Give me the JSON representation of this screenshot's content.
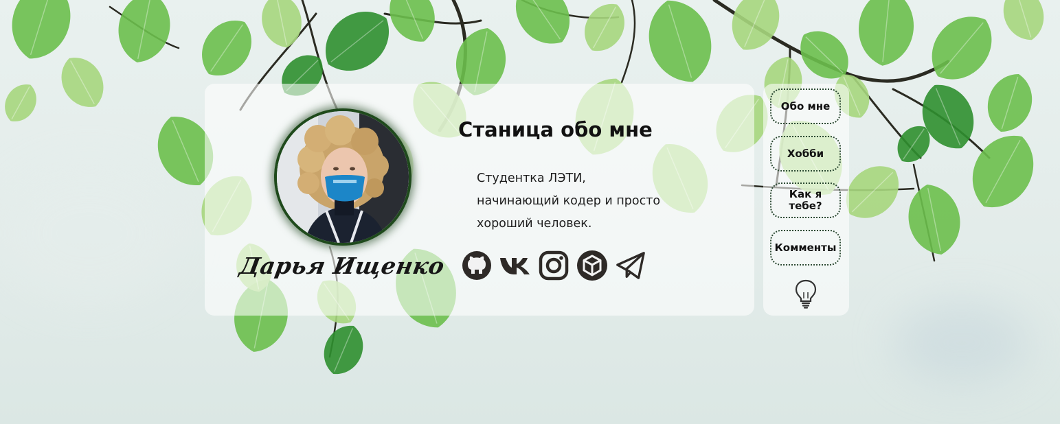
{
  "profile": {
    "name": "Дарья Ищенко",
    "avatar_icon": "profile-photo"
  },
  "page": {
    "title": "Станица обо мне",
    "bio_lines": [
      "Студентка ЛЭТИ,",
      "начинающий кодер и просто",
      "хороший человек."
    ]
  },
  "socials": [
    {
      "name": "github",
      "icon": "github-icon"
    },
    {
      "name": "vk",
      "icon": "vk-icon"
    },
    {
      "name": "instagram",
      "icon": "instagram-icon"
    },
    {
      "name": "codepen",
      "icon": "cube-icon"
    },
    {
      "name": "telegram",
      "icon": "telegram-icon"
    }
  ],
  "nav": {
    "items": [
      {
        "label": "Обо мне"
      },
      {
        "label": "Хобби"
      },
      {
        "label": "Как я тебе?"
      },
      {
        "label": "Комменты"
      }
    ],
    "theme_toggle_icon": "lightbulb-icon"
  },
  "colors": {
    "leaf_light": "#a6d67d",
    "leaf_mid": "#6cbf4c",
    "leaf_dark": "#2f8f2f",
    "branch": "#2b2b22",
    "nav_border": "#2c4a33",
    "mask_blue": "#1c86c8"
  }
}
